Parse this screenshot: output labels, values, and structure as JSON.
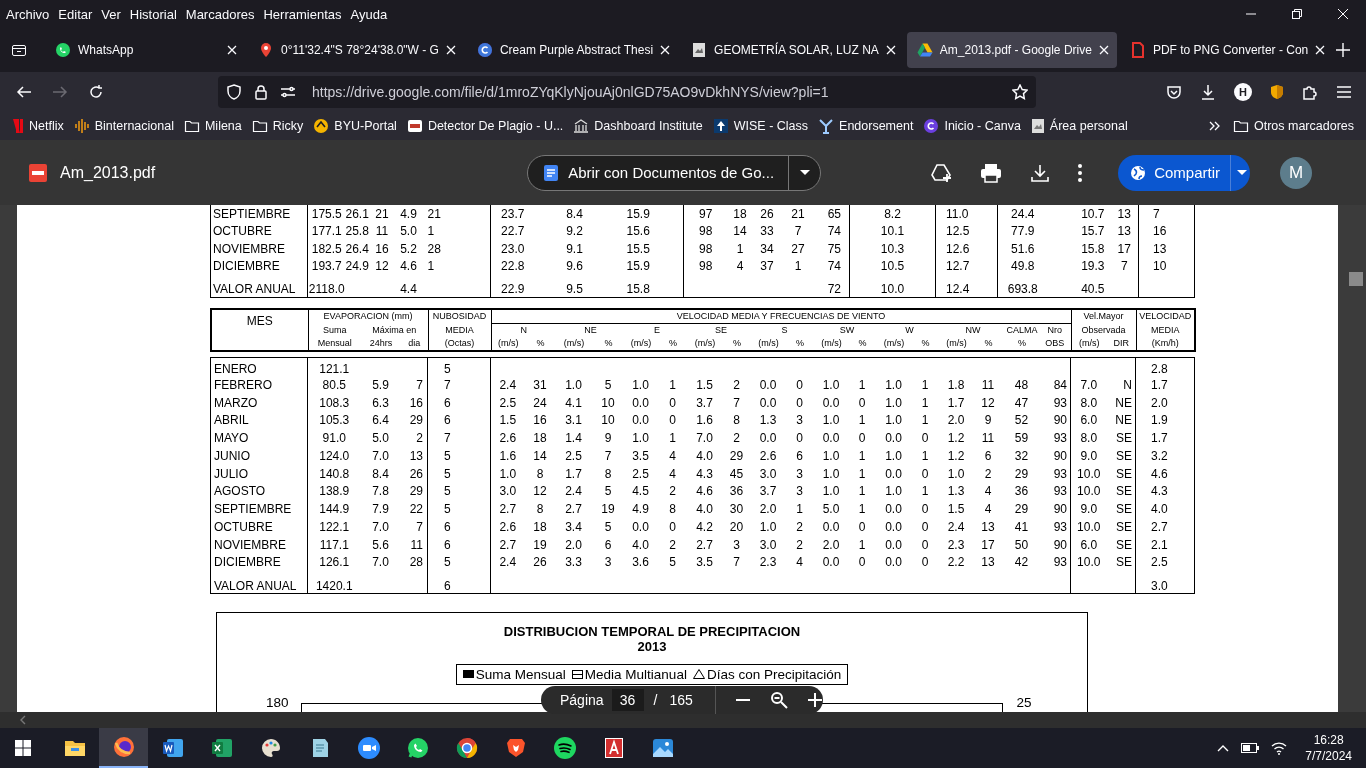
{
  "menu": [
    "Archivo",
    "Editar",
    "Ver",
    "Historial",
    "Marcadores",
    "Herramientas",
    "Ayuda"
  ],
  "tabs": [
    {
      "title": "WhatsApp",
      "selected": false
    },
    {
      "title": "0°11'32.4\"S 78°24'38.0\"W - G",
      "selected": false
    },
    {
      "title": "Cream Purple Abstract Thesi",
      "selected": false
    },
    {
      "title": "GEOMETRÍA SOLAR, LUZ NA",
      "selected": false
    },
    {
      "title": "Am_2013.pdf - Google Drive",
      "selected": true
    },
    {
      "title": "PDF to PNG Converter - Con",
      "selected": false
    }
  ],
  "address_bar": {
    "url": "https://drive.google.com/file/d/1mroZYqKlyNjouAj0nlGD75AO9vDkhNYS/view?pli=1"
  },
  "profile_badge": "H",
  "bookmarks": [
    "Netflix",
    "Binternacional",
    "Milena",
    "Ricky",
    "BYU-Portal",
    "Detector De Plagio - U...",
    "Dashboard Institute",
    "WISE - Class",
    "Endorsement",
    "Inicio - Canva",
    "Área personal"
  ],
  "other_bookmarks": "Otros marcadores",
  "viewer": {
    "file_name": "Am_2013.pdf",
    "open_with": "Abrir con Documentos de Go...",
    "share": "Compartir",
    "avatar": "M",
    "upper_table": {
      "rows": [
        {
          "month": "SEPTIEMBRE",
          "values": [
            "175.5",
            "26.1",
            "21",
            "4.9",
            "21",
            "23.7",
            "8.4",
            "15.9",
            "97",
            "18",
            "26",
            "21",
            "65",
            "8.2",
            "11.0",
            "24.4",
            "10.7",
            "13",
            "7"
          ]
        },
        {
          "month": "OCTUBRE",
          "values": [
            "177.1",
            "25.8",
            "11",
            "5.0",
            "1",
            "22.7",
            "9.2",
            "15.6",
            "98",
            "14",
            "33",
            "7",
            "74",
            "10.1",
            "12.5",
            "77.9",
            "15.7",
            "13",
            "16"
          ]
        },
        {
          "month": "NOVIEMBRE",
          "values": [
            "182.5",
            "26.4",
            "16",
            "5.2",
            "28",
            "23.0",
            "9.1",
            "15.5",
            "98",
            "1",
            "34",
            "27",
            "75",
            "10.3",
            "12.6",
            "51.6",
            "15.8",
            "17",
            "13"
          ]
        },
        {
          "month": "DICIEMBRE",
          "values": [
            "193.7",
            "24.9",
            "12",
            "4.6",
            "1",
            "22.8",
            "9.6",
            "15.9",
            "98",
            "4",
            "37",
            "1",
            "74",
            "10.5",
            "12.7",
            "49.8",
            "19.3",
            "7",
            "10"
          ]
        }
      ],
      "annual_row": {
        "month": "VALOR ANUAL",
        "cells": {
          "column_1": "2118.0",
          "column_4": "4.4",
          "column_6": "22.9",
          "column_7": "9.5",
          "column_8": "15.8",
          "column_13": "72",
          "column_14": "10.0",
          "column_15": "12.4",
          "column_16": "693.8",
          "column_17": "40.5"
        }
      }
    },
    "lower_table": {
      "header_rows": [
        [
          {
            "text": "MES",
            "rowspan": 3
          },
          {
            "text": "EVAPORACION (mm)",
            "colspan": 3
          },
          {
            "text": "NUBOSIDAD"
          },
          {
            "text": "VELOCIDAD MEDIA Y FRECUENCIAS DE VIENTO",
            "colspan": 18
          },
          {
            "text": "Vel.Mayor",
            "colspan": 2
          },
          {
            "text": "VELOCIDAD"
          }
        ],
        [
          {
            "text": "Suma"
          },
          {
            "text": "Máxima en",
            "colspan": 2
          },
          {
            "text": "MEDIA"
          },
          {
            "text": "N",
            "colspan": 2
          },
          {
            "text": "NE",
            "colspan": 2
          },
          {
            "text": "E",
            "colspan": 2
          },
          {
            "text": "SE",
            "colspan": 2
          },
          {
            "text": "S",
            "colspan": 2
          },
          {
            "text": "SW",
            "colspan": 2
          },
          {
            "text": "W",
            "colspan": 2
          },
          {
            "text": "NW",
            "colspan": 2
          },
          {
            "text": "CALMA"
          },
          {
            "text": "Nro"
          },
          {
            "text": "Observada",
            "colspan": 2
          },
          {
            "text": "MEDIA"
          }
        ],
        [
          {
            "text": "Mensual"
          },
          {
            "text": "24hrs"
          },
          {
            "text": "dia"
          },
          {
            "text": "(Octas)"
          },
          {
            "text": "(m/s)"
          },
          {
            "text": "%"
          },
          {
            "text": "(m/s)"
          },
          {
            "text": "%"
          },
          {
            "text": "(m/s)"
          },
          {
            "text": "%"
          },
          {
            "text": "(m/s)"
          },
          {
            "text": "%"
          },
          {
            "text": "(m/s)"
          },
          {
            "text": "%"
          },
          {
            "text": "(m/s)"
          },
          {
            "text": "%"
          },
          {
            "text": "(m/s)"
          },
          {
            "text": "%"
          },
          {
            "text": "(m/s)"
          },
          {
            "text": "%"
          },
          {
            "text": "%"
          },
          {
            "text": "OBS"
          },
          {
            "text": "(m/s)"
          },
          {
            "text": "DIR"
          },
          {
            "text": "(Km/h)"
          }
        ]
      ],
      "rows": [
        {
          "month": "ENERO",
          "cells": {
            "evap_sum": "121.1",
            "cloudiness": "5",
            "mean_kmh": "2.8"
          }
        },
        {
          "month": "FEBRERO",
          "values": [
            "80.5",
            "5.9",
            "7",
            "7",
            "2.4",
            "31",
            "1.0",
            "5",
            "1.0",
            "1",
            "1.5",
            "2",
            "0.0",
            "0",
            "1.0",
            "1",
            "1.0",
            "1",
            "1.8",
            "11",
            "48",
            "84",
            "7.0",
            "N",
            "1.7"
          ]
        },
        {
          "month": "MARZO",
          "values": [
            "108.3",
            "6.3",
            "16",
            "6",
            "2.5",
            "24",
            "4.1",
            "10",
            "0.0",
            "0",
            "3.7",
            "7",
            "0.0",
            "0",
            "0.0",
            "0",
            "1.0",
            "1",
            "1.7",
            "12",
            "47",
            "93",
            "8.0",
            "NE",
            "2.0"
          ]
        },
        {
          "month": "ABRIL",
          "values": [
            "105.3",
            "6.4",
            "29",
            "6",
            "1.5",
            "16",
            "3.1",
            "10",
            "0.0",
            "0",
            "1.6",
            "8",
            "1.3",
            "3",
            "1.0",
            "1",
            "1.0",
            "1",
            "2.0",
            "9",
            "52",
            "90",
            "6.0",
            "NE",
            "1.9"
          ]
        },
        {
          "month": "MAYO",
          "values": [
            "91.0",
            "5.0",
            "2",
            "7",
            "2.6",
            "18",
            "1.4",
            "9",
            "1.0",
            "1",
            "7.0",
            "2",
            "0.0",
            "0",
            "0.0",
            "0",
            "0.0",
            "0",
            "1.2",
            "11",
            "59",
            "93",
            "8.0",
            "SE",
            "1.7"
          ]
        },
        {
          "month": "JUNIO",
          "values": [
            "124.0",
            "7.0",
            "13",
            "5",
            "1.6",
            "14",
            "2.5",
            "7",
            "3.5",
            "4",
            "4.0",
            "29",
            "2.6",
            "6",
            "1.0",
            "1",
            "1.0",
            "1",
            "1.2",
            "6",
            "32",
            "90",
            "9.0",
            "SE",
            "3.2"
          ]
        },
        {
          "month": "JULIO",
          "values": [
            "140.8",
            "8.4",
            "26",
            "5",
            "1.0",
            "8",
            "1.7",
            "8",
            "2.5",
            "4",
            "4.3",
            "45",
            "3.0",
            "3",
            "1.0",
            "1",
            "0.0",
            "0",
            "1.0",
            "2",
            "29",
            "93",
            "10.0",
            "SE",
            "4.6"
          ]
        },
        {
          "month": "AGOSTO",
          "values": [
            "138.9",
            "7.8",
            "29",
            "5",
            "3.0",
            "12",
            "2.4",
            "5",
            "4.5",
            "2",
            "4.6",
            "36",
            "3.7",
            "3",
            "1.0",
            "1",
            "1.0",
            "1",
            "1.3",
            "4",
            "36",
            "93",
            "10.0",
            "SE",
            "4.3"
          ]
        },
        {
          "month": "SEPTIEMBRE",
          "values": [
            "144.9",
            "7.9",
            "22",
            "5",
            "2.7",
            "8",
            "2.7",
            "19",
            "4.9",
            "8",
            "4.0",
            "30",
            "2.0",
            "1",
            "5.0",
            "1",
            "0.0",
            "0",
            "1.5",
            "4",
            "29",
            "90",
            "9.0",
            "SE",
            "4.0"
          ]
        },
        {
          "month": "OCTUBRE",
          "values": [
            "122.1",
            "7.0",
            "7",
            "6",
            "2.6",
            "18",
            "3.4",
            "5",
            "0.0",
            "0",
            "4.2",
            "20",
            "1.0",
            "2",
            "0.0",
            "0",
            "0.0",
            "0",
            "2.4",
            "13",
            "41",
            "93",
            "10.0",
            "SE",
            "2.7"
          ]
        },
        {
          "month": "NOVIEMBRE",
          "values": [
            "117.1",
            "5.6",
            "11",
            "6",
            "2.7",
            "19",
            "2.0",
            "6",
            "4.0",
            "2",
            "2.7",
            "3",
            "3.0",
            "2",
            "2.0",
            "1",
            "0.0",
            "0",
            "2.3",
            "17",
            "50",
            "90",
            "6.0",
            "SE",
            "2.1"
          ]
        },
        {
          "month": "DICIEMBRE",
          "values": [
            "126.1",
            "7.0",
            "28",
            "5",
            "2.4",
            "26",
            "3.3",
            "3",
            "3.6",
            "5",
            "3.5",
            "7",
            "2.3",
            "4",
            "0.0",
            "0",
            "0.0",
            "0",
            "2.2",
            "13",
            "42",
            "93",
            "10.0",
            "SE",
            "2.5"
          ]
        }
      ],
      "annual_row": {
        "month": "VALOR ANUAL",
        "cells": {
          "evap_sum": "1420.1",
          "cloudiness": "6",
          "mean_kmh": "3.0"
        }
      }
    },
    "chart": {
      "title": "DISTRIBUCION TEMPORAL DE PRECIPITACION",
      "subtitle": "2013",
      "legend": [
        {
          "label": "Suma Mensual",
          "kind": "filled"
        },
        {
          "label": "Media Multianual",
          "kind": "hatched"
        },
        {
          "label": "Días con Precipitación",
          "kind": "triangle"
        }
      ],
      "left_axis_label": "180",
      "right_axis_label": "25"
    },
    "page_control": {
      "label": "Página",
      "page": "36",
      "separator": "/",
      "total": "165"
    }
  },
  "taskbar": {
    "apps": [
      {
        "selected": false
      },
      {
        "selected": true
      },
      {
        "selected": false
      },
      {
        "selected": false
      },
      {
        "selected": false
      },
      {
        "selected": false
      },
      {
        "selected": false
      },
      {
        "selected": false
      },
      {
        "selected": false
      },
      {
        "selected": false
      },
      {
        "selected": false
      },
      {
        "selected": false
      },
      {
        "selected": false
      }
    ],
    "time": "16:28",
    "date": "7/7/2024"
  }
}
